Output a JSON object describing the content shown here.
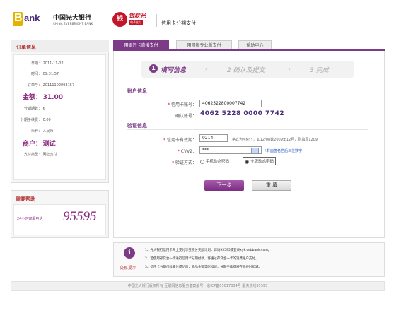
{
  "header": {
    "bank_letter": "B",
    "bank_word": "ank",
    "bank_cn": "中国光大银行",
    "bank_en": "CHINA EVERBRIGHT BANK",
    "partner_icon": "银",
    "partner_name": "银联光",
    "partner_sub": "电子支付",
    "title": "信用卡分期支付"
  },
  "order": {
    "heading": "订单信息",
    "rows": [
      {
        "label": "日期：",
        "value": "2011-11-02"
      },
      {
        "label": "时间：",
        "value": "09:31:57"
      },
      {
        "label": "订单号：",
        "value": "20111102093157"
      },
      {
        "label": "金额：",
        "value": "31.00"
      },
      {
        "label": "分期期数：",
        "value": "6"
      },
      {
        "label": "分期手续费：",
        "value": "0.00"
      },
      {
        "label": "币种：",
        "value": "人民币"
      },
      {
        "label": "商户：",
        "value": "测试"
      },
      {
        "label": "支付类型：",
        "value": "网上支付"
      }
    ]
  },
  "help": {
    "heading": "需要帮助",
    "label": "24小时客服电话",
    "phone": "95595"
  },
  "tabs": [
    {
      "label": "用银行卡直接支付"
    },
    {
      "label": "用网银专业版支付"
    },
    {
      "label": "帮助中心"
    }
  ],
  "steps": {
    "step1_num": "1",
    "step1": "填写信息",
    "step2": "2 确认及提交",
    "step3": "3 完成",
    "arrow": "›"
  },
  "account": {
    "title": "账户信息",
    "card_label": "信用卡账号：",
    "card_value": "4062522800007742",
    "confirm_label": "确认账号：",
    "confirm_value": "4062 5228 0000 7742"
  },
  "verify": {
    "title": "验证信息",
    "expiry_label": "信用卡有效期：",
    "expiry_value": "0214",
    "expiry_hint": "格式为MMYY，如12/08数2009年12月，则填写1209",
    "cvv_label": "CVV2：",
    "cvv_value": "***",
    "cvv_link": "卡背面签名栏后三位数字",
    "method_label": "验证方式：",
    "method_options": [
      "手机动态密码",
      "令牌动态密码"
    ]
  },
  "buttons": {
    "next": "下一步",
    "reset": "重 填"
  },
  "tips": {
    "icon": "i",
    "label": "交易提示",
    "lines": [
      "1、光大银行信用卡网上支付享受积分奖励计划，详询95595或登录xyk.cebbank.com。",
      "2、若使用存贷合一卡进行信用卡分期付款，将通过存贷合一卡的消费账户支付。",
      "3、信用卡分期付款支付成功后，商品金额实时扣减，分期手续费将在日终时扣减。"
    ]
  },
  "footer": {
    "text": "中国光大银行版权所有 互联网信息服务备案编号：京ICP备05017034号 服务热线95595"
  }
}
